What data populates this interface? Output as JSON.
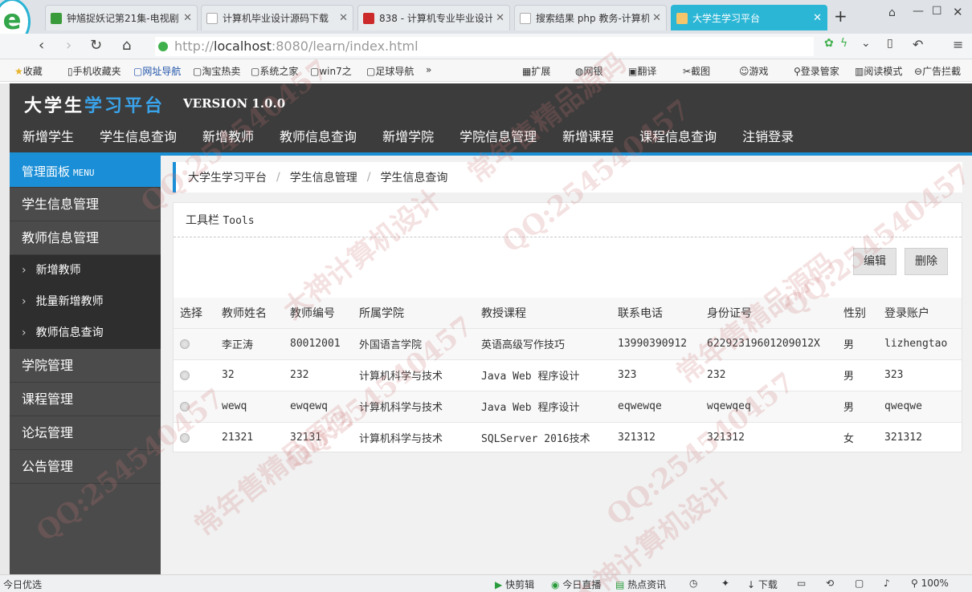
{
  "browser": {
    "tabs": [
      {
        "label": "钟馗捉妖记第21集-电视剧",
        "favicon_color": "#3a9b3a"
      },
      {
        "label": "计算机毕业设计源码下载",
        "favicon_color": "#ffffff"
      },
      {
        "label": "838 - 计算机专业毕业设计",
        "favicon_color": "#cc2a2a"
      },
      {
        "label": "搜索结果 php 教务-计算机",
        "favicon_color": "#ffffff"
      },
      {
        "label": "大学生学习平台",
        "favicon_color": "#f4c56a"
      }
    ],
    "new_tab": "+",
    "url_prefix": "http://",
    "url_host": "localhost",
    "url_rest": ":8080/learn/index.html",
    "bookmarks": [
      "收藏",
      "手机收藏夹",
      "网址导航",
      "淘宝热卖",
      "系统之家",
      "win7之",
      "足球导航",
      "»"
    ],
    "toolbar_right": [
      "扩展",
      "网银",
      "翻译",
      "截图",
      "游戏",
      "登录管家",
      "阅读模式",
      "广告拦截"
    ]
  },
  "app": {
    "brand_part1": "大学生",
    "brand_part2": "学习平台",
    "version": "VERSION 1.0.0",
    "topnav": [
      "新增学生",
      "学生信息查询",
      "新增教师",
      "教师信息查询",
      "新增学院",
      "学院信息管理",
      "新增课程",
      "课程信息查询",
      "注销登录"
    ],
    "sidebar": {
      "header": "管理面板",
      "header_en": "MENU",
      "items_before": [
        "学生信息管理",
        "教师信息管理"
      ],
      "sub_items": [
        "新增教师",
        "批量新增教师",
        "教师信息查询"
      ],
      "items_after": [
        "学院管理",
        "课程管理",
        "论坛管理",
        "公告管理"
      ]
    },
    "breadcrumb": [
      "大学生学习平台",
      "学生信息管理",
      "学生信息查询"
    ],
    "breadcrumb_sep": "/",
    "tools_title": "工具栏",
    "tools_title_en": "Tools",
    "buttons": {
      "edit": "编辑",
      "delete": "删除"
    },
    "table": {
      "columns": [
        "选择",
        "教师姓名",
        "教师编号",
        "所属学院",
        "教授课程",
        "联系电话",
        "身份证号",
        "性别",
        "登录账户"
      ],
      "rows": [
        [
          "",
          "李正涛",
          "80012001",
          "外国语言学院",
          "英语高级写作技巧",
          "13990390912",
          "62292319601209012X",
          "男",
          "lizhengtao"
        ],
        [
          "",
          "32",
          "232",
          "计算机科学与技术",
          "Java Web 程序设计",
          "323",
          "232",
          "男",
          "323"
        ],
        [
          "",
          "wewq",
          "ewqewq",
          "计算机科学与技术",
          "Java Web 程序设计",
          "eqwewqe",
          "wqewqeq",
          "男",
          "qweqwe"
        ],
        [
          "",
          "21321",
          "32131",
          "计算机科学与技术",
          "SQLServer 2016技术",
          "321312",
          "321312",
          "女",
          "321312"
        ]
      ]
    }
  },
  "statusbar": {
    "left": "今日优选",
    "items": [
      "快剪辑",
      "今日直播",
      "热点资讯",
      "下载",
      "100%"
    ]
  },
  "watermark": {
    "texts": [
      "QQ:254540457",
      "大神计算机设计",
      "常年售精品源码"
    ]
  },
  "colors": {
    "accent": "#1a8ed6",
    "header_bg": "#3c3c3c",
    "sidebar_bg": "#4b4b4b",
    "active_tab": "#2cb6d6"
  }
}
